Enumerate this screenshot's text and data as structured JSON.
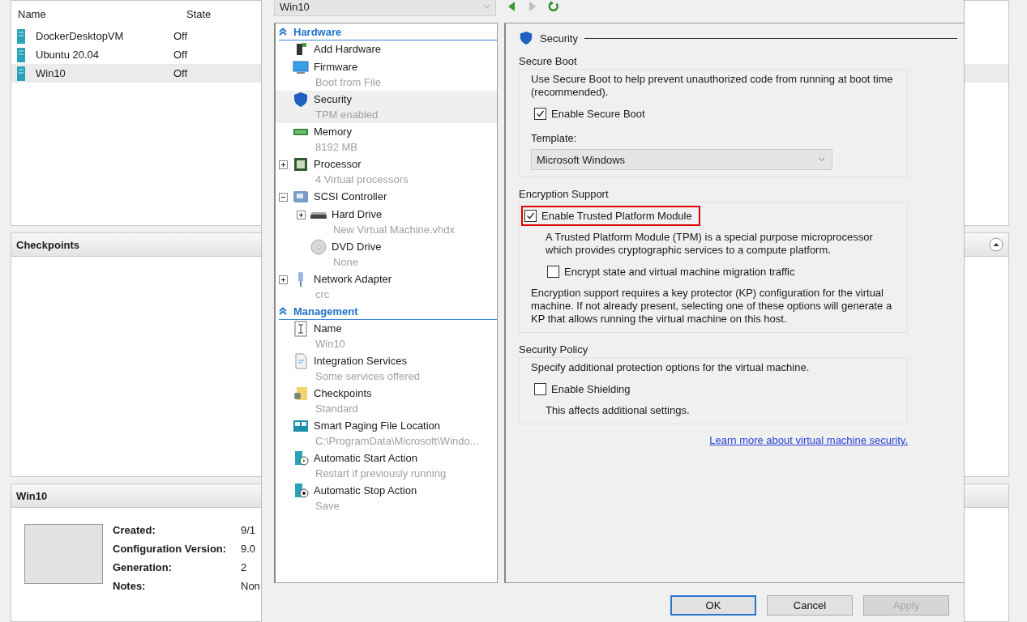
{
  "manager": {
    "vm_table": {
      "columns": [
        "Name",
        "State"
      ],
      "rows": [
        {
          "name": "DockerDesktopVM",
          "state": "Off",
          "selected": false
        },
        {
          "name": "Ubuntu 20.04",
          "state": "Off",
          "selected": false
        },
        {
          "name": "Win10",
          "state": "Off",
          "selected": true
        }
      ]
    },
    "checkpoints_pane": {
      "title": "Checkpoints"
    },
    "details_pane": {
      "title": "Win10",
      "fields": [
        {
          "label": "Created:",
          "value": "9/1"
        },
        {
          "label": "Configuration Version:",
          "value": "9.0"
        },
        {
          "label": "Generation:",
          "value": "2"
        },
        {
          "label": "Notes:",
          "value": "Non"
        }
      ]
    }
  },
  "dialog": {
    "vm_selector": {
      "value": "Win10"
    },
    "tree": [
      {
        "title": "Hardware",
        "items": [
          {
            "kind": "add-hardware",
            "label": "Add Hardware",
            "selected": false
          },
          {
            "kind": "firmware",
            "label": "Firmware",
            "detail": "Boot from File",
            "selected": false
          },
          {
            "kind": "security",
            "label": "Security",
            "detail": "TPM enabled",
            "selected": true
          },
          {
            "kind": "memory",
            "label": "Memory",
            "detail": "8192 MB",
            "selected": false
          },
          {
            "kind": "processor",
            "label": "Processor",
            "detail": "4 Virtual processors",
            "selected": false,
            "expanded": false
          },
          {
            "kind": "scsi",
            "label": "SCSI Controller",
            "selected": false,
            "expanded": true,
            "children": [
              {
                "kind": "hard-drive",
                "label": "Hard Drive",
                "detail": "New Virtual Machine.vhdx",
                "selected": false,
                "expanded": false
              },
              {
                "kind": "dvd",
                "label": "DVD Drive",
                "detail": "None",
                "selected": false
              }
            ]
          },
          {
            "kind": "network",
            "label": "Network Adapter",
            "detail": "crc",
            "selected": false,
            "expanded": false
          }
        ]
      },
      {
        "title": "Management",
        "items": [
          {
            "kind": "name",
            "label": "Name",
            "detail": "Win10",
            "selected": false
          },
          {
            "kind": "integration",
            "label": "Integration Services",
            "detail": "Some services offered",
            "selected": false
          },
          {
            "kind": "checkpoints",
            "label": "Checkpoints",
            "detail": "Standard",
            "selected": false
          },
          {
            "kind": "paging",
            "label": "Smart Paging File Location",
            "detail": "C:\\ProgramData\\Microsoft\\Windo...",
            "selected": false
          },
          {
            "kind": "start",
            "label": "Automatic Start Action",
            "detail": "Restart if previously running",
            "selected": false
          },
          {
            "kind": "stop",
            "label": "Automatic Stop Action",
            "detail": "Save",
            "selected": false
          }
        ]
      }
    ],
    "settings": {
      "title": "Security",
      "groups": [
        {
          "title": "Secure Boot",
          "items": [
            {
              "kind": "text",
              "text": "Use Secure Boot to help prevent unauthorized code from running at boot time (recommended)."
            },
            {
              "kind": "checkbox",
              "label": "Enable Secure Boot",
              "checked": true
            },
            {
              "kind": "select",
              "label": "Template:",
              "value": "Microsoft Windows"
            }
          ]
        },
        {
          "title": "Encryption Support",
          "items": [
            {
              "kind": "checkbox",
              "label": "Enable Trusted Platform Module",
              "checked": true,
              "highlighted": true
            },
            {
              "kind": "text",
              "text": "A Trusted Platform Module (TPM) is a special purpose microprocessor which provides cryptographic services to a compute platform.",
              "indented": true
            },
            {
              "kind": "checkbox",
              "label": "Encrypt state and virtual machine migration traffic",
              "checked": false,
              "indented": true
            },
            {
              "kind": "text",
              "text": "Encryption support requires a key protector (KP) configuration for the virtual machine. If not already present, selecting one of these options will generate a KP that allows running the virtual machine on this host."
            }
          ]
        },
        {
          "title": "Security Policy",
          "items": [
            {
              "kind": "text",
              "text": "Specify additional protection options for the virtual machine."
            },
            {
              "kind": "checkbox",
              "label": "Enable Shielding",
              "checked": false
            },
            {
              "kind": "text",
              "text": "This affects additional settings.",
              "indented": true
            }
          ]
        }
      ],
      "link": "Learn more about virtual machine security."
    },
    "buttons": [
      {
        "label": "OK",
        "default": true,
        "disabled": false
      },
      {
        "label": "Cancel",
        "default": false,
        "disabled": false
      },
      {
        "label": "Apply",
        "default": false,
        "disabled": true
      }
    ]
  }
}
